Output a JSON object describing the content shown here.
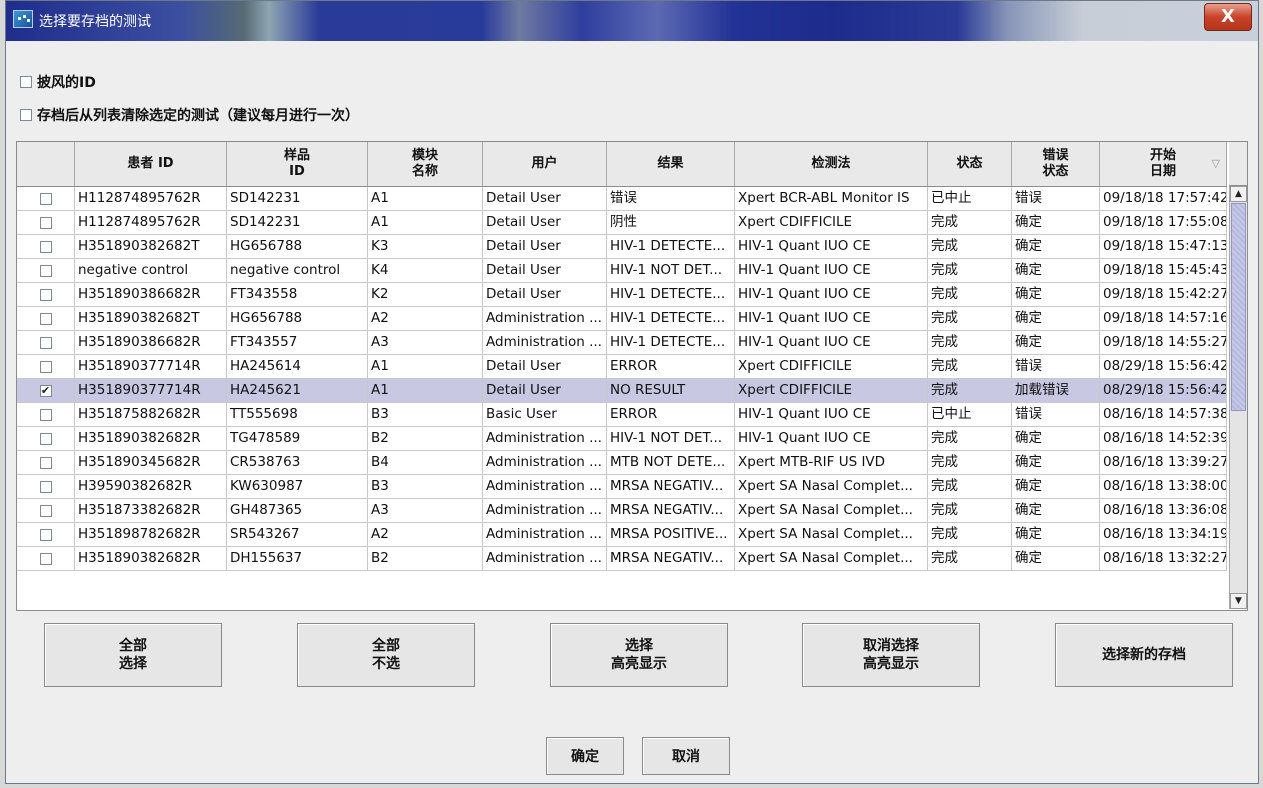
{
  "window": {
    "title": "选择要存档的测试",
    "close_label": "X"
  },
  "options": [
    {
      "label": "披风的ID",
      "checked": false
    },
    {
      "label": "存档后从列表清除选定的测试（建议每月进行一次）",
      "checked": false
    }
  ],
  "table": {
    "headers": [
      "",
      "患者 ID",
      "样品\nID",
      "模块\n名称",
      "用户",
      "结果",
      "检测法",
      "状态",
      "错误\n状态",
      "开始\n日期"
    ],
    "sort_icon": "▽",
    "rows": [
      {
        "checked": false,
        "selected": false,
        "cells": [
          "H112874895762R",
          "SD142231",
          "A1",
          "Detail User",
          "错误",
          "Xpert BCR-ABL Monitor IS",
          "已中止",
          "错误",
          "09/18/18 17:57:42"
        ]
      },
      {
        "checked": false,
        "selected": false,
        "cells": [
          "H112874895762R",
          "SD142231",
          "A1",
          "Detail User",
          "阴性",
          "Xpert CDIFFICILE",
          "完成",
          "确定",
          "09/18/18 17:55:08"
        ]
      },
      {
        "checked": false,
        "selected": false,
        "cells": [
          "H351890382682T",
          "HG656788",
          "K3",
          "Detail User",
          "HIV-1 DETECTE...",
          "HIV-1 Quant IUO CE",
          "完成",
          "确定",
          "09/18/18 15:47:13"
        ]
      },
      {
        "checked": false,
        "selected": false,
        "cells": [
          "negative control",
          "negative control",
          "K4",
          "Detail User",
          "HIV-1 NOT DET...",
          "HIV-1 Quant IUO CE",
          "完成",
          "确定",
          "09/18/18 15:45:43"
        ]
      },
      {
        "checked": false,
        "selected": false,
        "cells": [
          "H351890386682R",
          "FT343558",
          "K2",
          "Detail User",
          "HIV-1 DETECTE...",
          "HIV-1 Quant IUO CE",
          "完成",
          "确定",
          "09/18/18 15:42:27"
        ]
      },
      {
        "checked": false,
        "selected": false,
        "cells": [
          "H351890382682T",
          "HG656788",
          "A2",
          "Administration ...",
          "HIV-1 DETECTE...",
          "HIV-1 Quant IUO CE",
          "完成",
          "确定",
          "09/18/18 14:57:16"
        ]
      },
      {
        "checked": false,
        "selected": false,
        "cells": [
          "H351890386682R",
          "FT343557",
          "A3",
          "Administration ...",
          "HIV-1 DETECTE...",
          "HIV-1 Quant IUO CE",
          "完成",
          "确定",
          "09/18/18 14:55:27"
        ]
      },
      {
        "checked": false,
        "selected": false,
        "cells": [
          "H351890377714R",
          "HA245614",
          "A1",
          "Detail User",
          "ERROR",
          "Xpert CDIFFICILE",
          "完成",
          "错误",
          "08/29/18 15:56:42"
        ]
      },
      {
        "checked": true,
        "selected": true,
        "cells": [
          "H351890377714R",
          "HA245621",
          "A1",
          "Detail User",
          "NO RESULT",
          "Xpert CDIFFICILE",
          "完成",
          "加载错误",
          "08/29/18 15:56:42"
        ]
      },
      {
        "checked": false,
        "selected": false,
        "cells": [
          "H351875882682R",
          "TT555698",
          "B3",
          "Basic User",
          "ERROR",
          "HIV-1 Quant IUO CE",
          "已中止",
          "错误",
          "08/16/18 14:57:38"
        ]
      },
      {
        "checked": false,
        "selected": false,
        "cells": [
          "H351890382682R",
          "TG478589",
          "B2",
          "Administration ...",
          "HIV-1 NOT DET...",
          "HIV-1 Quant IUO CE",
          "完成",
          "确定",
          "08/16/18 14:52:39"
        ]
      },
      {
        "checked": false,
        "selected": false,
        "cells": [
          "H351890345682R",
          "CR538763",
          "B4",
          "Administration ...",
          "MTB NOT DETE...",
          "Xpert MTB-RIF US IVD",
          "完成",
          "确定",
          "08/16/18 13:39:27"
        ]
      },
      {
        "checked": false,
        "selected": false,
        "cells": [
          "H39590382682R",
          "KW630987",
          "B3",
          "Administration ...",
          "MRSA NEGATIV...",
          "Xpert SA Nasal Complet...",
          "完成",
          "确定",
          "08/16/18 13:38:00"
        ]
      },
      {
        "checked": false,
        "selected": false,
        "cells": [
          "H351873382682R",
          "GH487365",
          "A3",
          "Administration ...",
          "MRSA NEGATIV...",
          "Xpert SA Nasal Complet...",
          "完成",
          "确定",
          "08/16/18 13:36:08"
        ]
      },
      {
        "checked": false,
        "selected": false,
        "cells": [
          "H351898782682R",
          "SR543267",
          "A2",
          "Administration ...",
          "MRSA POSITIVE...",
          "Xpert SA Nasal Complet...",
          "完成",
          "确定",
          "08/16/18 13:34:19"
        ]
      },
      {
        "checked": false,
        "selected": false,
        "cells": [
          "H351890382682R",
          "DH155637",
          "B2",
          "Administration ...",
          "MRSA NEGATIV...",
          "Xpert SA Nasal Complet...",
          "完成",
          "确定",
          "08/16/18 13:32:27"
        ]
      }
    ]
  },
  "buttons": {
    "select_all": "全部\n选择",
    "select_none": "全部\n不选",
    "select_highlighted": "选择\n高亮显示",
    "deselect_highlighted": "取消选择\n高亮显示",
    "select_new_archive": "选择新的存档",
    "ok": "确定",
    "cancel": "取消"
  },
  "colors": {
    "selected_row": "#c9c8e3",
    "titlebar": "#2a3a98",
    "close_button": "#c8432a"
  }
}
